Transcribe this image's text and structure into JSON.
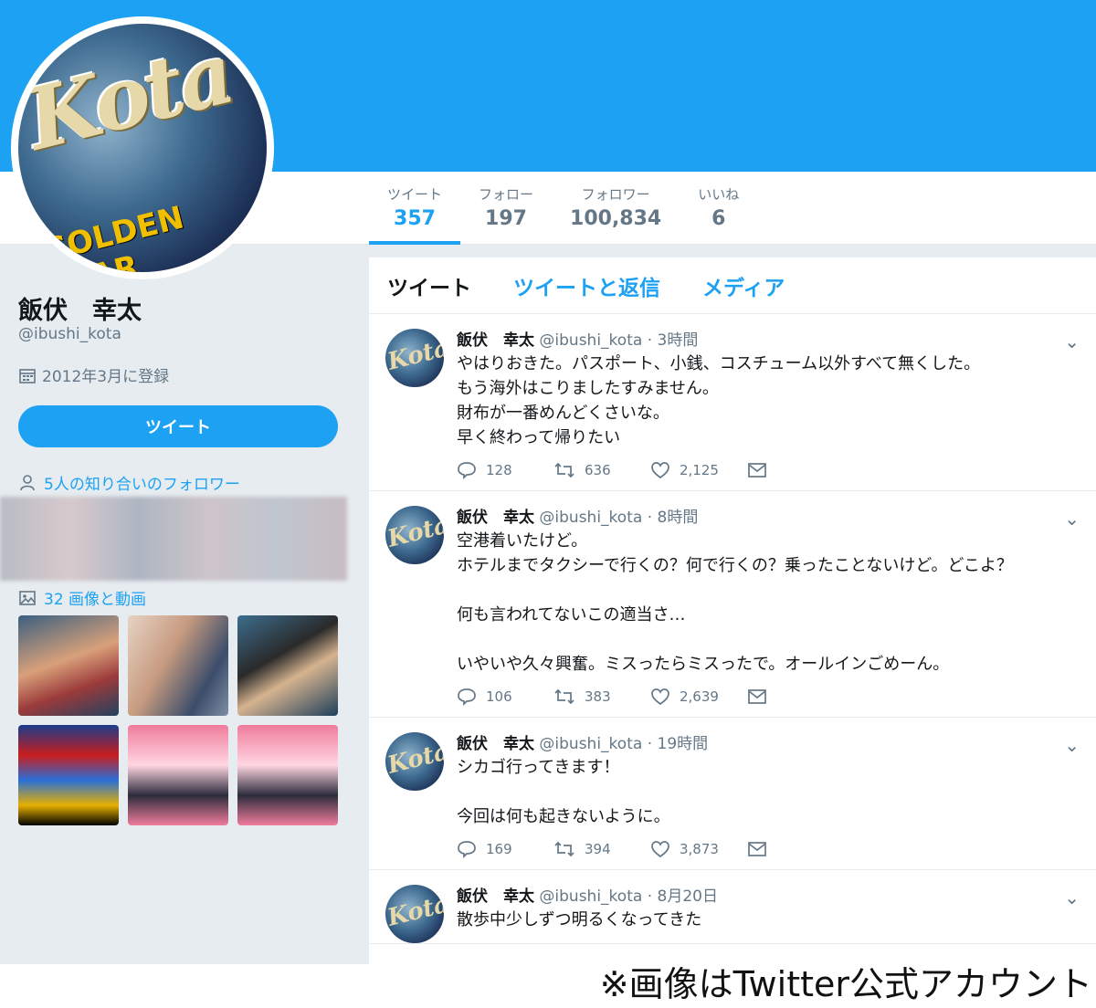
{
  "profile": {
    "avatar_text": "Kota",
    "avatar_sub": "GOLDEN STAR",
    "name": "飯伏　幸太",
    "handle": "@ibushi_kota",
    "joined": "2012年3月に登録",
    "tweet_button": "ツイート",
    "followers_you_know": "5人の知り合いのフォロワー",
    "media_link": "32 画像と動画"
  },
  "stats": [
    {
      "label": "ツイート",
      "value": "357"
    },
    {
      "label": "フォロー",
      "value": "197"
    },
    {
      "label": "フォロワー",
      "value": "100,834"
    },
    {
      "label": "いいね",
      "value": "6"
    }
  ],
  "tabs": [
    "ツイート",
    "ツイートと返信",
    "メディア"
  ],
  "tweets": [
    {
      "name": "飯伏　幸太",
      "handle": "@ibushi_kota",
      "time": "3時間",
      "text": "やはりおきた。パスポート、小銭、コスチューム以外すべて無くした。\nもう海外はこりましたすみません。\n財布が一番めんどくさいな。\n早く終わって帰りたい",
      "replies": "128",
      "retweets": "636",
      "likes": "2,125"
    },
    {
      "name": "飯伏　幸太",
      "handle": "@ibushi_kota",
      "time": "8時間",
      "text": "空港着いたけど。\nホテルまでタクシーで行くの？何で行くの？乗ったことないけど。どこよ？\n\n何も言われてないこの適当さ…\n\nいやいや久々興奮。ミスったらミスったで。オールインごめーん。",
      "replies": "106",
      "retweets": "383",
      "likes": "2,639"
    },
    {
      "name": "飯伏　幸太",
      "handle": "@ibushi_kota",
      "time": "19時間",
      "text": "シカゴ行ってきます！\n\n今回は何も起きないように。",
      "replies": "169",
      "retweets": "394",
      "likes": "3,873"
    },
    {
      "name": "飯伏　幸太",
      "handle": "@ibushi_kota",
      "time": "8月20日",
      "text": "散歩中少しずつ明るくなってきた",
      "replies": "",
      "retweets": "",
      "likes": ""
    }
  ],
  "caption": "※画像はTwitter公式アカウント",
  "colors": {
    "accent": "#1da1f2",
    "background": "#e6ecf0"
  }
}
